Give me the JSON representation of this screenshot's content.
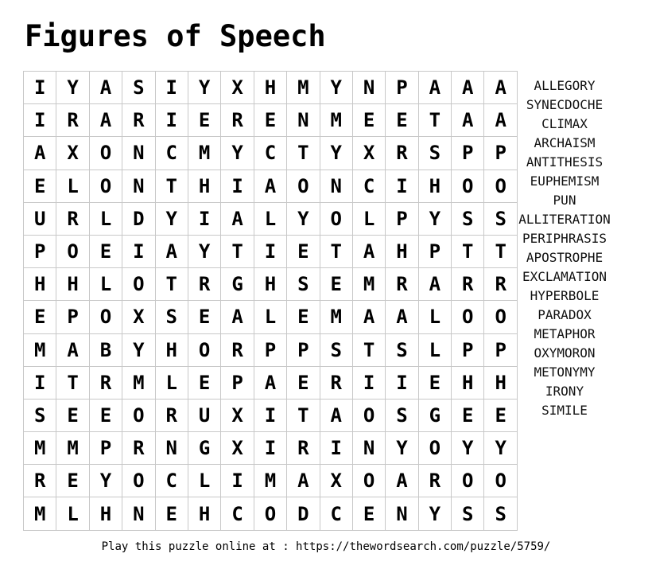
{
  "title": "Figures of Speech",
  "grid": [
    [
      "I",
      "Y",
      "A",
      "S",
      "I",
      "Y",
      "X",
      "H",
      "M",
      "Y",
      "N",
      "P",
      "A",
      "A",
      "A"
    ],
    [
      "I",
      "R",
      "A",
      "R",
      "I",
      "E",
      "R",
      "E",
      "N",
      "M",
      "E",
      "E",
      "T",
      "A",
      "A"
    ],
    [
      "A",
      "X",
      "O",
      "N",
      "C",
      "M",
      "Y",
      "C",
      "T",
      "Y",
      "X",
      "R",
      "S",
      "P",
      "P"
    ],
    [
      "E",
      "L",
      "O",
      "N",
      "T",
      "H",
      "I",
      "A",
      "O",
      "N",
      "C",
      "I",
      "H",
      "O",
      "O"
    ],
    [
      "U",
      "R",
      "L",
      "D",
      "Y",
      "I",
      "A",
      "L",
      "Y",
      "O",
      "L",
      "P",
      "Y",
      "S",
      "S"
    ],
    [
      "P",
      "O",
      "E",
      "I",
      "A",
      "Y",
      "T",
      "I",
      "E",
      "T",
      "A",
      "H",
      "P",
      "T",
      "T"
    ],
    [
      "H",
      "H",
      "L",
      "O",
      "T",
      "R",
      "G",
      "H",
      "S",
      "E",
      "M",
      "R",
      "A",
      "R",
      "R"
    ],
    [
      "E",
      "P",
      "O",
      "X",
      "S",
      "E",
      "A",
      "L",
      "E",
      "M",
      "A",
      "A",
      "L",
      "O",
      "O"
    ],
    [
      "M",
      "A",
      "B",
      "Y",
      "H",
      "O",
      "R",
      "P",
      "P",
      "S",
      "T",
      "S",
      "L",
      "P",
      "P"
    ],
    [
      "I",
      "T",
      "R",
      "M",
      "L",
      "E",
      "P",
      "A",
      "E",
      "R",
      "I",
      "I",
      "E",
      "H",
      "H"
    ],
    [
      "S",
      "E",
      "E",
      "O",
      "R",
      "U",
      "X",
      "I",
      "T",
      "A",
      "O",
      "S",
      "G",
      "E",
      "E"
    ],
    [
      "M",
      "M",
      "P",
      "R",
      "N",
      "G",
      "X",
      "I",
      "R",
      "I",
      "N",
      "Y",
      "O",
      "Y",
      "Y"
    ],
    [
      "R",
      "E",
      "Y",
      "O",
      "C",
      "L",
      "I",
      "M",
      "A",
      "X",
      "O",
      "A",
      "R",
      "O",
      "O"
    ],
    [
      "M",
      "L",
      "H",
      "N",
      "E",
      "H",
      "C",
      "O",
      "D",
      "C",
      "E",
      "N",
      "Y",
      "S",
      "S"
    ]
  ],
  "words": [
    "ALLEGORY",
    "SYNECDOCHE",
    "CLIMAX",
    "ARCHAISM",
    "ANTITHESIS",
    "EUPHEMISM",
    "PUN",
    "ALLITERATION",
    "PERIPHRASIS",
    "APOSTROPHE",
    "EXCLAMATION",
    "HYPERBOLE",
    "PARADOX",
    "METAPHOR",
    "OXYMORON",
    "METONYMY",
    "IRONY",
    "SIMILE"
  ],
  "footer": "Play this puzzle online at : https://thewordsearch.com/puzzle/5759/"
}
